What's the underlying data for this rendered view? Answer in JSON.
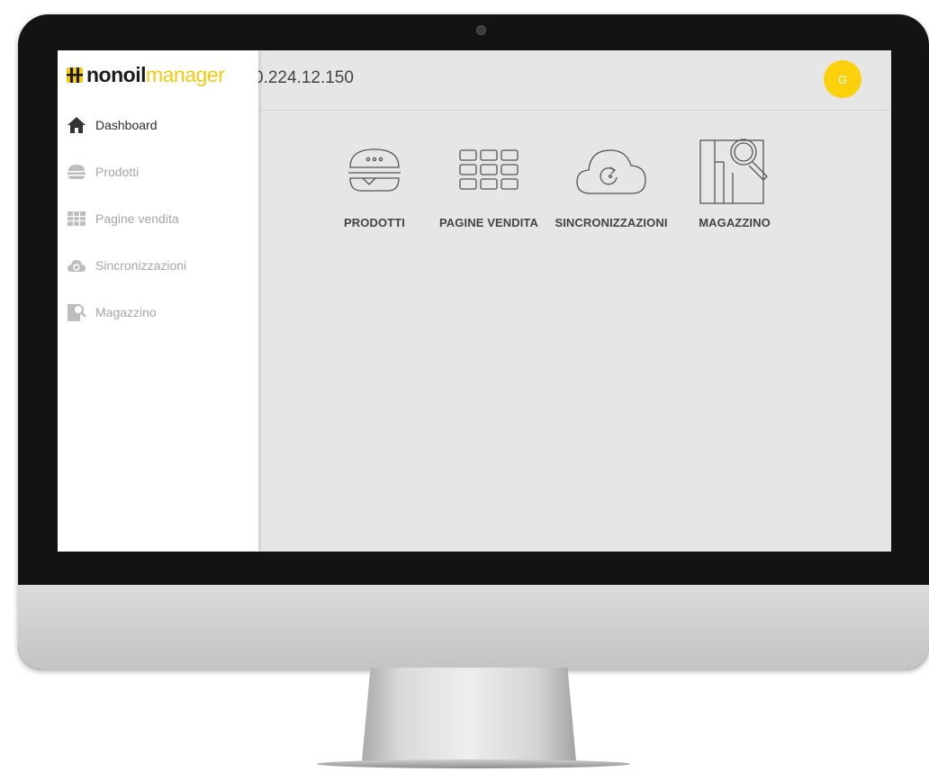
{
  "app": {
    "brand_part1": "nonoil",
    "brand_part2": "manager",
    "header_title": "0.224.12.150",
    "avatar_initial": "G",
    "accent_color": "#fbd10b"
  },
  "sidebar": {
    "items": [
      {
        "label": "Dashboard",
        "icon": "home-icon",
        "active": true
      },
      {
        "label": "Prodotti",
        "icon": "burger-icon",
        "active": false
      },
      {
        "label": "Pagine vendita",
        "icon": "grid-icon",
        "active": false
      },
      {
        "label": "Sincronizzazioni",
        "icon": "cloud-sync-icon",
        "active": false
      },
      {
        "label": "Magazzino",
        "icon": "warehouse-search-icon",
        "active": false
      }
    ]
  },
  "tiles": [
    {
      "label": "PRODOTTI",
      "icon": "burger-icon"
    },
    {
      "label": "PAGINE VENDITA",
      "icon": "grid-icon"
    },
    {
      "label": "SINCRONIZZAZIONI",
      "icon": "cloud-sync-icon"
    },
    {
      "label": "MAGAZZINO",
      "icon": "warehouse-search-icon"
    }
  ]
}
